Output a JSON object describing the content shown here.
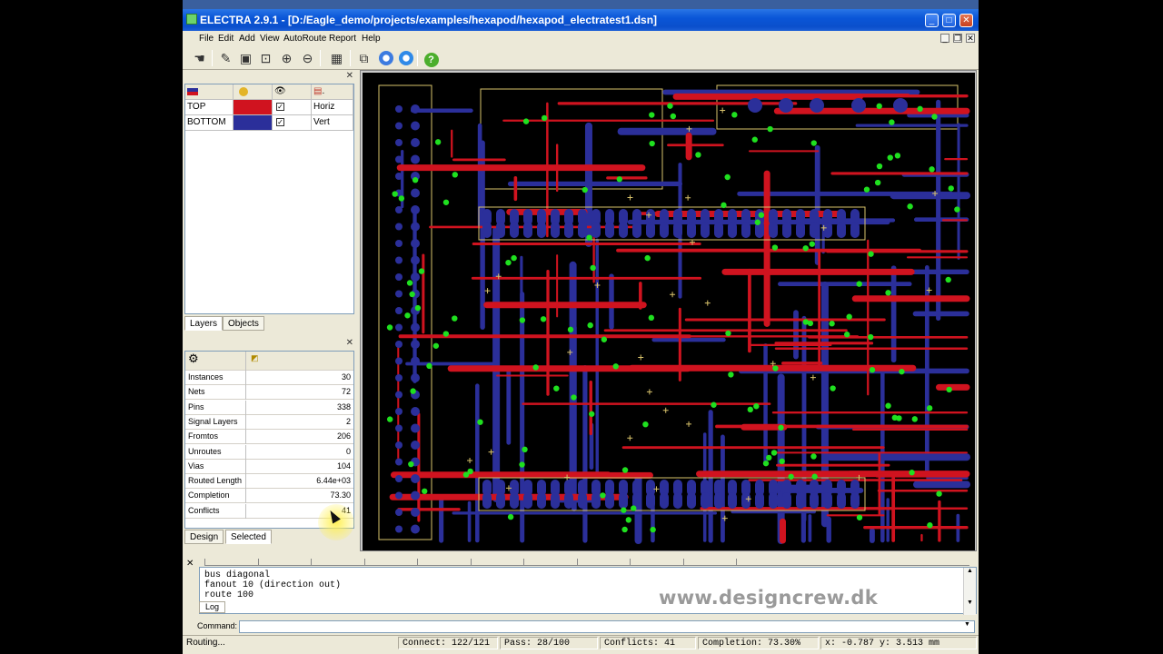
{
  "window": {
    "title": "ELECTRA 2.9.1 - [D:/Eagle_demo/projects/examples/hexapod/hexapod_electratest1.dsn]",
    "buttons": {
      "minimize": "_",
      "maximize": "□",
      "close": "✕"
    }
  },
  "menubar": {
    "items": [
      "File",
      "Edit",
      "Add",
      "View",
      "AutoRoute",
      "Report",
      "Help"
    ],
    "mdi": {
      "minimize": "_",
      "restore": "❐",
      "close": "✕"
    }
  },
  "toolbar": {
    "buttons": [
      {
        "name": "hand-tool",
        "icon": "hand-icon",
        "glyph": "☚"
      },
      {
        "name": "pencil-tool",
        "icon": "pencil-icon",
        "glyph": "✎"
      },
      {
        "name": "zoom-area",
        "icon": "zoom-area-icon",
        "glyph": "▣"
      },
      {
        "name": "zoom-fit",
        "icon": "zoom-fit-icon",
        "glyph": "⊡"
      },
      {
        "name": "zoom-in",
        "icon": "zoom-in-icon",
        "glyph": "⊕"
      },
      {
        "name": "zoom-out",
        "icon": "zoom-out-icon",
        "glyph": "⊖"
      },
      {
        "name": "grid",
        "icon": "grid-icon",
        "glyph": "▦"
      },
      {
        "name": "inspect",
        "icon": "inspect-icon",
        "glyph": "⧉"
      },
      {
        "name": "route",
        "icon": "route-icon",
        "glyph": ""
      },
      {
        "name": "stop",
        "icon": "stop-icon",
        "glyph": ""
      },
      {
        "name": "help",
        "icon": "help-icon",
        "glyph": "?"
      }
    ]
  },
  "layers": {
    "header_icons": [
      "layers-icon",
      "color-icon",
      "eye-icon",
      "direction-icon"
    ],
    "rows": [
      {
        "name": "TOP",
        "color": "#d0131f",
        "visible": "✓",
        "direction": "Horiz"
      },
      {
        "name": "BOTTOM",
        "color": "#2b2f9a",
        "visible": "✓",
        "direction": "Vert"
      }
    ],
    "tabs": [
      "Layers",
      "Objects"
    ]
  },
  "stats": {
    "rows": [
      {
        "label": "Instances",
        "value": "30"
      },
      {
        "label": "Nets",
        "value": "72"
      },
      {
        "label": "Pins",
        "value": "338"
      },
      {
        "label": "Signal Layers",
        "value": "2"
      },
      {
        "label": "Fromtos",
        "value": "206"
      },
      {
        "label": "Unroutes",
        "value": "0"
      },
      {
        "label": "Vias",
        "value": "104"
      },
      {
        "label": "Routed Length",
        "value": "6.44e+03"
      },
      {
        "label": "Completion",
        "value": "73.30"
      },
      {
        "label": "Conflicts",
        "value": "41"
      }
    ],
    "tabs": [
      "Design",
      "Selected"
    ]
  },
  "log": {
    "lines": [
      "bus diagonal",
      "fanout 10 (direction out)",
      "route 100"
    ],
    "tab": "Log",
    "watermark": "www.designcrew.dk"
  },
  "command": {
    "label": "Command:",
    "value": ""
  },
  "statusbar": {
    "state": "Routing...",
    "connect": "Connect: 122/121",
    "pass": "Pass: 28/100",
    "conflicts": "Conflicts: 41",
    "completion": "Completion: 73.30%",
    "coords": "x:  -0.787  y:   3.513  mm"
  },
  "colors": {
    "top_layer": "#d0131f",
    "bottom_layer": "#2b2f9a",
    "via": "#1fe01f",
    "outline": "#d9c36b",
    "pcb_background": "#000000"
  }
}
